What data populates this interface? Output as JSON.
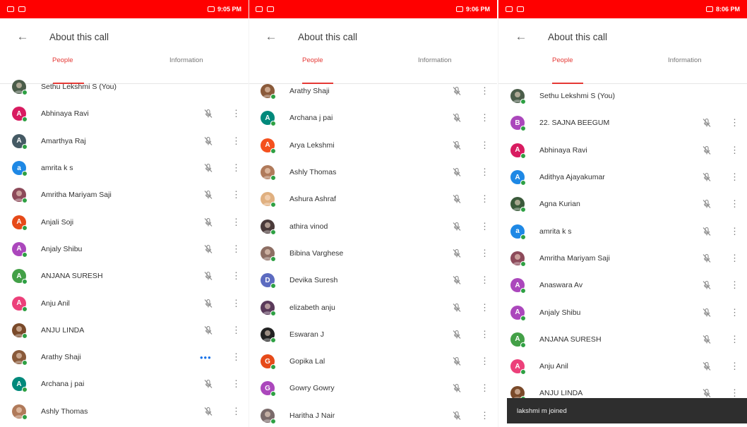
{
  "screens": [
    {
      "status_time": "9:05 PM",
      "title": "About this call",
      "tabs": [
        "People",
        "Information"
      ],
      "participants": [
        {
          "name": "Sethu Lekshmi S (You)",
          "letter": "",
          "color": "#4b5d4a",
          "photo": true,
          "mic": false,
          "more": false
        },
        {
          "name": "Abhinaya Ravi",
          "letter": "A",
          "color": "#d81b60",
          "photo": false,
          "mic": true,
          "more": true
        },
        {
          "name": "Amarthya Raj",
          "letter": "A",
          "color": "#455a64",
          "photo": false,
          "mic": true,
          "more": true
        },
        {
          "name": "amrita k s",
          "letter": "a",
          "color": "#1e88e5",
          "photo": false,
          "mic": true,
          "more": true
        },
        {
          "name": "Amritha Mariyam Saji",
          "letter": "",
          "color": "#8d4a5a",
          "photo": true,
          "mic": true,
          "more": true
        },
        {
          "name": "Anjali Soji",
          "letter": "A",
          "color": "#e64a19",
          "photo": false,
          "mic": true,
          "more": true
        },
        {
          "name": "Anjaly Shibu",
          "letter": "A",
          "color": "#ab47bc",
          "photo": false,
          "mic": true,
          "more": true
        },
        {
          "name": "ANJANA SURESH",
          "letter": "A",
          "color": "#43a047",
          "photo": false,
          "mic": true,
          "more": true
        },
        {
          "name": "Anju Anil",
          "letter": "A",
          "color": "#ec407a",
          "photo": false,
          "mic": true,
          "more": true
        },
        {
          "name": "ANJU LINDA",
          "letter": "",
          "color": "#7a4a2a",
          "photo": true,
          "mic": true,
          "more": true
        },
        {
          "name": "Arathy Shaji",
          "letter": "",
          "color": "#8a5a3a",
          "photo": true,
          "mic": false,
          "more": true,
          "speaking": true
        },
        {
          "name": "Archana j pai",
          "letter": "A",
          "color": "#00897b",
          "photo": false,
          "mic": true,
          "more": true
        },
        {
          "name": "Ashly Thomas",
          "letter": "",
          "color": "#b07a5a",
          "photo": true,
          "mic": true,
          "more": true
        }
      ]
    },
    {
      "status_time": "9:06 PM",
      "title": "About this call",
      "tabs": [
        "People",
        "Information"
      ],
      "participants": [
        {
          "name": "Arathy Shaji",
          "letter": "",
          "color": "#8a5a3a",
          "photo": true,
          "mic": true,
          "more": true
        },
        {
          "name": "Archana j pai",
          "letter": "A",
          "color": "#00897b",
          "photo": false,
          "mic": true,
          "more": true
        },
        {
          "name": "Arya Lekshmi",
          "letter": "A",
          "color": "#f4511e",
          "photo": false,
          "mic": true,
          "more": true
        },
        {
          "name": "Ashly Thomas",
          "letter": "",
          "color": "#b07a5a",
          "photo": true,
          "mic": true,
          "more": true
        },
        {
          "name": "Ashura Ashraf",
          "letter": "",
          "color": "#e0b080",
          "photo": true,
          "mic": true,
          "more": true
        },
        {
          "name": "athira vinod",
          "letter": "",
          "color": "#4a3a3a",
          "photo": true,
          "mic": true,
          "more": true
        },
        {
          "name": "Bibina Varghese",
          "letter": "",
          "color": "#8d6e63",
          "photo": true,
          "mic": true,
          "more": true
        },
        {
          "name": "Devika Suresh",
          "letter": "D",
          "color": "#5c6bc0",
          "photo": false,
          "mic": true,
          "more": true
        },
        {
          "name": "elizabeth anju",
          "letter": "",
          "color": "#5a3a5a",
          "photo": true,
          "mic": true,
          "more": true
        },
        {
          "name": "Eswaran J",
          "letter": "",
          "color": "#222222",
          "photo": true,
          "mic": true,
          "more": true
        },
        {
          "name": "Gopika Lal",
          "letter": "G",
          "color": "#e64a19",
          "photo": false,
          "mic": true,
          "more": true
        },
        {
          "name": "Gowry Gowry",
          "letter": "G",
          "color": "#ab47bc",
          "photo": false,
          "mic": true,
          "more": true
        },
        {
          "name": "Haritha J Nair",
          "letter": "",
          "color": "#7a6a6a",
          "photo": true,
          "mic": true,
          "more": true
        }
      ]
    },
    {
      "status_time": "8:06 PM",
      "title": "About this call",
      "tabs": [
        "People",
        "Information"
      ],
      "participants": [
        {
          "name": "Sethu Lekshmi S (You)",
          "letter": "",
          "color": "#4b5d4a",
          "photo": true,
          "mic": false,
          "more": false
        },
        {
          "name": "22. SAJNA BEEGUM",
          "letter": "B",
          "color": "#ab47bc",
          "photo": false,
          "mic": true,
          "more": true
        },
        {
          "name": "Abhinaya Ravi",
          "letter": "A",
          "color": "#d81b60",
          "photo": false,
          "mic": true,
          "more": true
        },
        {
          "name": "Adithya Ajayakumar",
          "letter": "A",
          "color": "#1e88e5",
          "photo": false,
          "mic": true,
          "more": true
        },
        {
          "name": "Agna Kurian",
          "letter": "",
          "color": "#3a5a3a",
          "photo": true,
          "mic": true,
          "more": true
        },
        {
          "name": "amrita k s",
          "letter": "a",
          "color": "#1e88e5",
          "photo": false,
          "mic": true,
          "more": true
        },
        {
          "name": "Amritha Mariyam Saji",
          "letter": "",
          "color": "#8d4a5a",
          "photo": true,
          "mic": true,
          "more": true
        },
        {
          "name": "Anaswara Av",
          "letter": "A",
          "color": "#ab47bc",
          "photo": false,
          "mic": true,
          "more": true
        },
        {
          "name": "Anjaly Shibu",
          "letter": "A",
          "color": "#ab47bc",
          "photo": false,
          "mic": true,
          "more": true
        },
        {
          "name": "ANJANA SURESH",
          "letter": "A",
          "color": "#43a047",
          "photo": false,
          "mic": true,
          "more": true
        },
        {
          "name": "Anju Anil",
          "letter": "A",
          "color": "#ec407a",
          "photo": false,
          "mic": true,
          "more": true
        },
        {
          "name": "ANJU LINDA",
          "letter": "",
          "color": "#7a4a2a",
          "photo": true,
          "mic": true,
          "more": true
        }
      ]
    }
  ],
  "snackbar": "lakshmi m joined",
  "colors": {
    "status_bar": "#ff0000",
    "accent": "#e53935",
    "online_dot": "#2ea043"
  },
  "icons": {
    "back": "arrow-left-icon",
    "mic": "mic-off-icon",
    "more": "more-vert-icon"
  }
}
